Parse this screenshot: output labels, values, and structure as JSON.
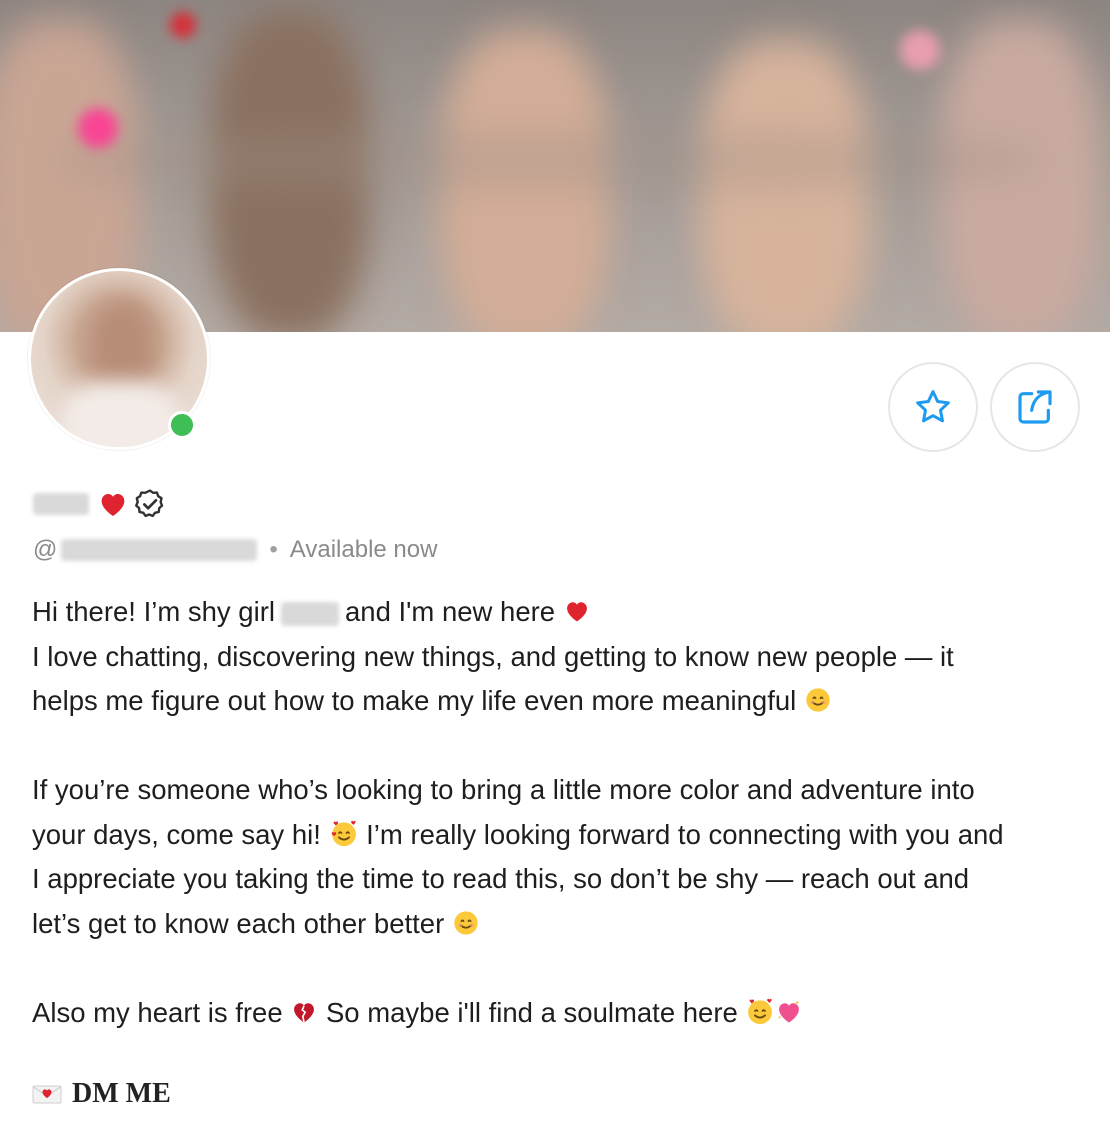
{
  "profile": {
    "status": "Available now",
    "handle_prefix": "@",
    "separator": "•",
    "icons": [
      "red-heart-icon",
      "verified-badge-icon",
      "star-icon",
      "share-icon",
      "online-status-icon"
    ]
  },
  "bio": {
    "line1_before": "Hi there! I’m shy girl",
    "line1_after": "and I'm new here",
    "line2": "I love chatting, discovering new things, and getting to know new people — it",
    "line3": "helps me figure out how to make my life even more meaningful",
    "line4": "If you’re someone who’s looking to bring a little more color and adventure into",
    "line5_before": "your days, come say hi!",
    "line5_after": "I’m really looking forward to connecting with you and",
    "line6": "I appreciate you taking the time to read this, so don’t be shy — reach out and",
    "line7": "let’s get to know each other better",
    "line8_before": "Also my heart is free",
    "line8_after": "So maybe i'll find a soulmate here"
  },
  "cta": {
    "label": "DM ME",
    "icon": "love-letter-icon"
  },
  "colors": {
    "online": "#3fbe55",
    "accent": "#1d9bf0",
    "heart": "#e0242f"
  }
}
